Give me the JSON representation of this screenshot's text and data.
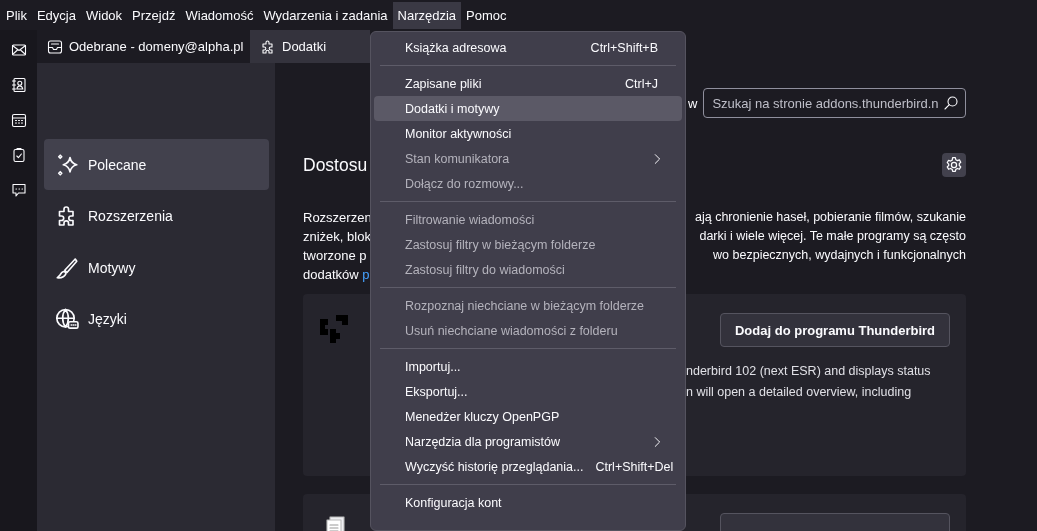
{
  "menubar": [
    {
      "label": "Plik",
      "selected": false
    },
    {
      "label": "Edycja",
      "selected": false
    },
    {
      "label": "Widok",
      "selected": false
    },
    {
      "label": "Przejdź",
      "selected": false
    },
    {
      "label": "Wiadomość",
      "selected": false
    },
    {
      "label": "Wydarzenia i zadania",
      "selected": false
    },
    {
      "label": "Narzędzia",
      "selected": true
    },
    {
      "label": "Pomoc",
      "selected": false
    }
  ],
  "tabs": [
    {
      "label": "Odebrane - domeny@alpha.pl",
      "kind": "mail",
      "selected": false
    },
    {
      "label": "Dodatki",
      "kind": "addons",
      "selected": true
    }
  ],
  "sidebar": {
    "items": [
      {
        "label": "Polecane",
        "kind": "recommended",
        "selected": true
      },
      {
        "label": "Rozszerzenia",
        "kind": "extensions",
        "selected": false
      },
      {
        "label": "Motywy",
        "kind": "themes",
        "selected": false
      },
      {
        "label": "Języki",
        "kind": "languages",
        "selected": false
      }
    ]
  },
  "content": {
    "search_prefix": "w",
    "search": {
      "placeholder": "Szukaj na stronie addons.thunderbird.n"
    },
    "heading": "Dostosu",
    "intro": {
      "left_lines": [
        "Rozszerzen",
        "zniżek, blok",
        "tworzone p"
      ],
      "last_line": {
        "text": "dodatków",
        "link": "p"
      },
      "right_lines": [
        "ają chronienie haseł, pobieranie filmów, szukanie",
        "darki i wiele więcej. Te małe programy są często",
        "wo bezpiecznych, wydajnych i funkcjonalnych"
      ]
    },
    "cards": [
      {
        "kind": "extension",
        "button": "Dodaj do programu Thunderbird",
        "description_lines": [
          "nderbird 102 (next ESR) and displays status",
          "n will open a detailed overview, including"
        ]
      },
      {
        "kind": "document"
      }
    ]
  },
  "menu": {
    "items": [
      {
        "kind": "item",
        "label": "Książka adresowa",
        "shortcut": "Ctrl+Shift+B",
        "disabled": false,
        "selected": false,
        "submenu": false
      },
      {
        "kind": "separator"
      },
      {
        "kind": "item",
        "label": "Zapisane pliki",
        "shortcut": "Ctrl+J",
        "disabled": false,
        "selected": false,
        "submenu": false
      },
      {
        "kind": "item",
        "label": "Dodatki i motywy",
        "disabled": false,
        "selected": true,
        "submenu": false
      },
      {
        "kind": "item",
        "label": "Monitor aktywności",
        "disabled": false,
        "selected": false,
        "submenu": false
      },
      {
        "kind": "item",
        "label": "Stan komunikatora",
        "disabled": true,
        "selected": false,
        "submenu": true
      },
      {
        "kind": "item",
        "label": "Dołącz do rozmowy...",
        "disabled": true,
        "selected": false,
        "submenu": false
      },
      {
        "kind": "separator"
      },
      {
        "kind": "item",
        "label": "Filtrowanie wiadomości",
        "disabled": true,
        "selected": false,
        "submenu": false
      },
      {
        "kind": "item",
        "label": "Zastosuj filtry w bieżącym folderze",
        "disabled": true,
        "selected": false,
        "submenu": false
      },
      {
        "kind": "item",
        "label": "Zastosuj filtry do wiadomości",
        "disabled": true,
        "selected": false,
        "submenu": false
      },
      {
        "kind": "separator"
      },
      {
        "kind": "item",
        "label": "Rozpoznaj niechciane w bieżącym folderze",
        "disabled": true,
        "selected": false,
        "submenu": false
      },
      {
        "kind": "item",
        "label": "Usuń niechciane wiadomości z folderu",
        "disabled": true,
        "selected": false,
        "submenu": false
      },
      {
        "kind": "separator"
      },
      {
        "kind": "item",
        "label": "Importuj...",
        "disabled": false,
        "selected": false,
        "submenu": false
      },
      {
        "kind": "item",
        "label": "Eksportuj...",
        "disabled": false,
        "selected": false,
        "submenu": false
      },
      {
        "kind": "item",
        "label": "Menedżer kluczy OpenPGP",
        "disabled": false,
        "selected": false,
        "submenu": false
      },
      {
        "kind": "item",
        "label": "Narzędzia dla programistów",
        "disabled": false,
        "selected": false,
        "submenu": true
      },
      {
        "kind": "item",
        "label": "Wyczyść historię przeglądania...",
        "shortcut": "Ctrl+Shift+Del",
        "disabled": false,
        "selected": false,
        "submenu": false
      },
      {
        "kind": "separator"
      },
      {
        "kind": "item",
        "label": "Konfiguracja kont",
        "disabled": false,
        "selected": false,
        "submenu": false
      }
    ]
  }
}
